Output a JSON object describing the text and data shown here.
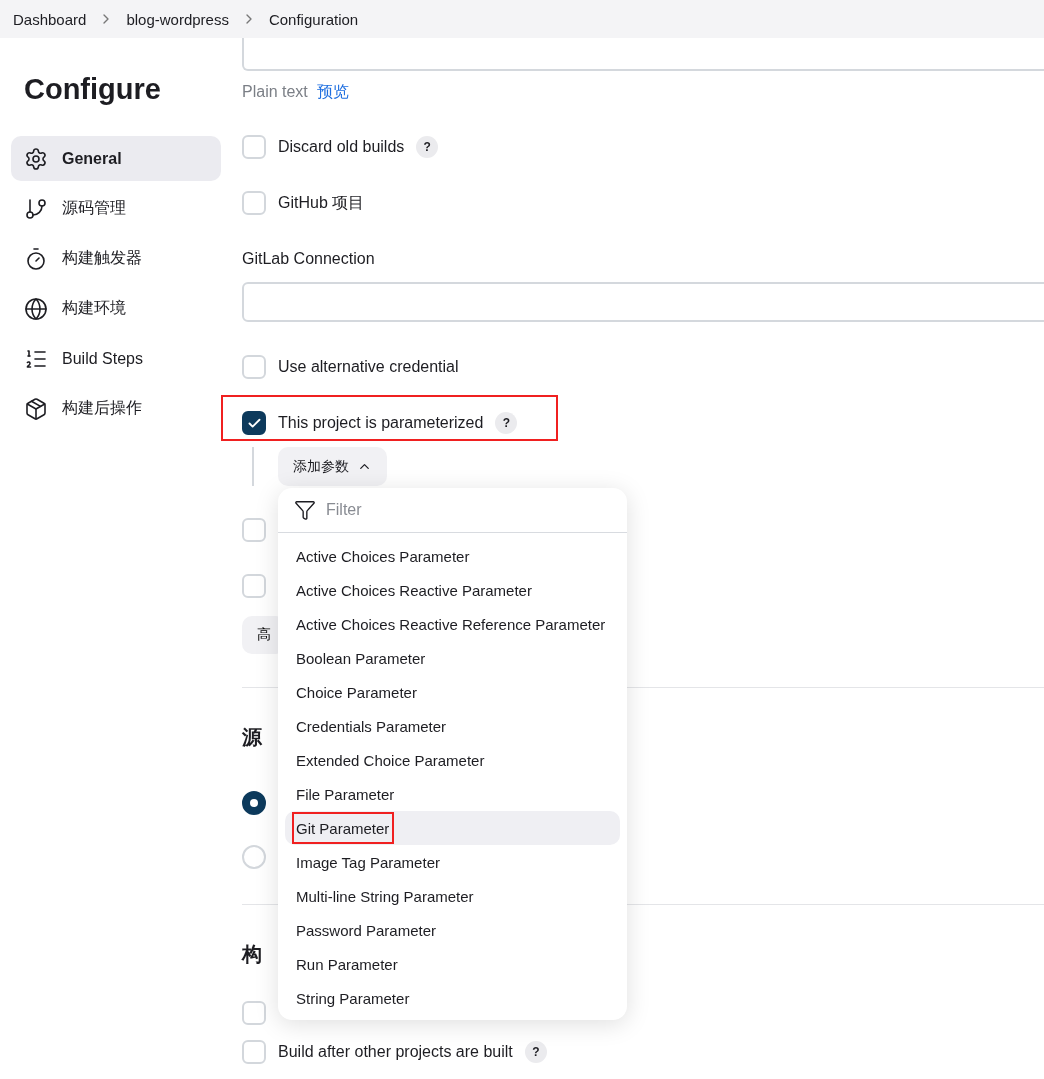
{
  "breadcrumbs": [
    "Dashboard",
    "blog-wordpress",
    "Configuration"
  ],
  "sidebar": {
    "title": "Configure",
    "items": [
      {
        "label": "General",
        "selected": true
      },
      {
        "label": "源码管理",
        "selected": false
      },
      {
        "label": "构建触发器",
        "selected": false
      },
      {
        "label": "构建环境",
        "selected": false
      },
      {
        "label": "Build Steps",
        "selected": false
      },
      {
        "label": "构建后操作",
        "selected": false
      }
    ]
  },
  "sections": [
    {
      "rows": [
        {
          "kind": "textarea"
        },
        {
          "kind": "format",
          "text": "Plain text",
          "link": "预览"
        },
        {
          "kind": "checkbox",
          "label": "Discard old builds",
          "checked": false,
          "help": "?",
          "highlighted": false
        },
        {
          "kind": "checkbox",
          "label": "GitHub 项目",
          "checked": false,
          "highlighted": false
        },
        {
          "kind": "field_label",
          "text": "GitLab Connection"
        },
        {
          "kind": "field"
        },
        {
          "kind": "checkbox",
          "label": "Use alternative credential",
          "checked": false,
          "highlighted": false
        },
        {
          "kind": "checkbox",
          "label": "This project is parameterized",
          "checked": true,
          "help": "?",
          "highlighted": true
        },
        {
          "kind": "menu_button",
          "label": "添加参数",
          "expanded": true,
          "menu": {
            "placeholder": "Filter",
            "items": [
              {
                "label": "Active Choices Parameter",
                "selected": false,
                "highlighted": false
              },
              {
                "label": "Active Choices Reactive Parameter",
                "selected": false,
                "highlighted": false
              },
              {
                "label": "Active Choices Reactive Reference Parameter",
                "selected": false,
                "highlighted": false
              },
              {
                "label": "Boolean Parameter",
                "selected": false,
                "highlighted": false
              },
              {
                "label": "Choice Parameter",
                "selected": false,
                "highlighted": false
              },
              {
                "label": "Credentials Parameter",
                "selected": false,
                "highlighted": false
              },
              {
                "label": "Extended Choice Parameter",
                "selected": false,
                "highlighted": false
              },
              {
                "label": "File Parameter",
                "selected": false,
                "highlighted": false
              },
              {
                "label": "Git Parameter",
                "selected": true,
                "highlighted": true
              },
              {
                "label": "Image Tag Parameter",
                "selected": false,
                "highlighted": false
              },
              {
                "label": "Multi-line String Parameter",
                "selected": false,
                "highlighted": false
              },
              {
                "label": "Password Parameter",
                "selected": false,
                "highlighted": false
              },
              {
                "label": "Run Parameter",
                "selected": false,
                "highlighted": false
              },
              {
                "label": "String Parameter",
                "selected": false,
                "highlighted": false
              }
            ]
          }
        },
        {
          "kind": "checkbox",
          "checked": false
        },
        {
          "kind": "checkbox",
          "checked": false
        },
        {
          "kind": "button",
          "label": "高"
        }
      ]
    },
    {
      "heading": "源",
      "rows": [
        {
          "kind": "radio",
          "selected": true
        },
        {
          "kind": "radio",
          "selected": false
        }
      ]
    },
    {
      "heading": "构",
      "rows": [
        {
          "kind": "checkbox",
          "checked": false
        },
        {
          "kind": "checkbox",
          "label": "Build after other projects are built",
          "checked": false,
          "help": "?",
          "highlighted": false
        }
      ]
    }
  ]
}
